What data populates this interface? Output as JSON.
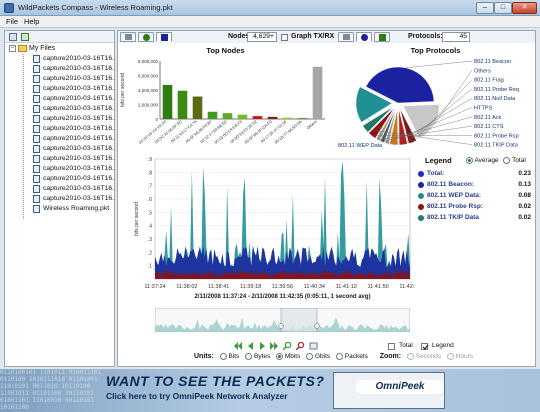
{
  "window": {
    "title": "WildPackets Compass - Wireless Roaming.pkt",
    "min_label": "–",
    "max_label": "□",
    "close_label": "✕"
  },
  "menu": [
    "File",
    "Help"
  ],
  "sidebar": {
    "root": "My Files",
    "root_expander": "−",
    "files": [
      "capture2010-03-16T16.37.0",
      "capture2010-03-16T16.37.1",
      "capture2010-03-16T16.37.1",
      "capture2010-03-16T16.37.2",
      "capture2010-03-16T16.37.3",
      "capture2010-03-16T16.37.4",
      "capture2010-03-16T16.37.4",
      "capture2010-03-16T16.37.5",
      "capture2010-03-16T16.38.0",
      "capture2010-03-16T16.38.0",
      "capture2010-03-16T16.38.1",
      "capture2010-03-16T16.38.1",
      "capture2010-03-16T16.38.2",
      "capture2010-03-16T16.38.3",
      "capture2010-03-16T16.38.3",
      "Wireless Roaming.pkt"
    ]
  },
  "toolbar": {
    "nodes_label": "Nodes:",
    "nodes_value": "4,629+",
    "graph_txrx_label": "Graph TX/RX",
    "protocols_label": "Protocols:",
    "protocols_value": "45"
  },
  "top_nodes": {
    "title": "Top Nodes",
    "y_axis_label": "bits per second",
    "chart_data": {
      "type": "bar",
      "categories": [
        "FF:FF:FF:FF:FF:FF",
        "00:0C:41:05:0F:5D",
        "00:11:93:17:C3:76",
        "00:0F:66:49:F0:8F",
        "00:12:17:69:6B:5D",
        "00:15:6D:E4:EA:F3",
        "00:0D:93:F5:2E:02",
        "00:0F:66:2F:CA:E0",
        "00:17:3F:47:01:0F",
        "00:1B:77:4A:5D:0A",
        "Others"
      ],
      "values": [
        4700000,
        3900000,
        3100000,
        1000000,
        800000,
        600000,
        400000,
        300000,
        200000,
        150000,
        7200000
      ],
      "colors": [
        "#2f7d12",
        "#3d8a16",
        "#5b6b12",
        "#3f9b1f",
        "#5caa22",
        "#7cb826",
        "#c81818",
        "#8a1c1c",
        "#9ad12a",
        "#3ea83a",
        "#a6a6a6"
      ],
      "ylim": [
        0,
        8000000
      ],
      "ytick_labels": [
        "8,000,000",
        "6,000,000",
        "4,000,000",
        "2,000,000",
        "0"
      ]
    }
  },
  "top_protocols": {
    "title": "Top Protocols",
    "chart_data": {
      "type": "pie",
      "labels": [
        "802.11 Beacon",
        "Others",
        "802.11 Frag",
        "802.11 Probe Req",
        "802.11 Null Data",
        "HTTPS",
        "802.11 Ack",
        "802.11 CTS",
        "802.11 Probe Rsp",
        "802.11 TKIP Data",
        "802.11 WEP Data"
      ],
      "values": [
        23,
        10,
        2,
        2,
        2,
        1,
        1,
        1,
        2,
        2,
        9
      ],
      "colors": [
        "#1a22a0",
        "#c8c8c8",
        "#7a1c1c",
        "#b02020",
        "#cc7a22",
        "#a0a0a0",
        "#555555",
        "#999999",
        "#8a1414",
        "#1e7a6a",
        "#1f9094"
      ]
    }
  },
  "throughput": {
    "y_axis_label": "bits per second",
    "chart_data": {
      "type": "area",
      "ylim": [
        0,
        9
      ],
      "ytick_labels": [
        ".9",
        ".8",
        ".7",
        ".6",
        ".5",
        ".4",
        ".3",
        ".2",
        ".1"
      ],
      "xtick_labels": [
        "11:37:24",
        "11:38:02",
        "11:38:41",
        "11:39:18",
        "11:39:56",
        "11:40:34",
        "11:41:12",
        "11:41:50",
        "11:42:28"
      ],
      "series": [
        {
          "name": "802.11 Beacon:",
          "color": "#1a22a0"
        },
        {
          "name": "802.11 WEP Data:",
          "color": "#1f9094"
        },
        {
          "name": "802.11 Probe Rsp:",
          "color": "#8a1414"
        }
      ]
    },
    "caption": "2/11/2008 11:37:24 - 2/11/2008 11:42:35  (0:05:11, 1 second avg)"
  },
  "legend": {
    "title": "Legend",
    "average_label": "Average",
    "total_label": "Total",
    "rows": [
      {
        "name": "Total:",
        "value": "0.23",
        "color": "#1a2ad0"
      },
      {
        "name": "802.11 Beacon:",
        "value": "0.13",
        "color": "#1a22a0"
      },
      {
        "name": "802.11 WEP Data:",
        "value": "0.08",
        "color": "#1f9094"
      },
      {
        "name": "802.11 Probe Rsp:",
        "value": "0.02",
        "color": "#8a1414"
      },
      {
        "name": "802.11 TKIP Data",
        "value": "0.02",
        "color": "#1e7a6a"
      }
    ]
  },
  "controls": {
    "total_label": "Total",
    "legend_label": "Legend",
    "units_label": "Units:",
    "units": [
      "Bits",
      "Bytes",
      "Mbits",
      "Gbits",
      "Packets"
    ],
    "zoom_label": "Zoom:",
    "zoom_options": [
      "Seconds",
      "Hours"
    ]
  },
  "banner": {
    "headline": "WANT TO SEE THE PACKETS?",
    "sub": "Click here to try OmniPeek Network Analyzer",
    "logo": "OmniPeek",
    "bits": "0110100101 1101011 010011101 0110100 1010111010 01101001 11010101 0011010 10110100 11001011 01101100 10110101 01001101 11010010 00110101 10101100"
  }
}
